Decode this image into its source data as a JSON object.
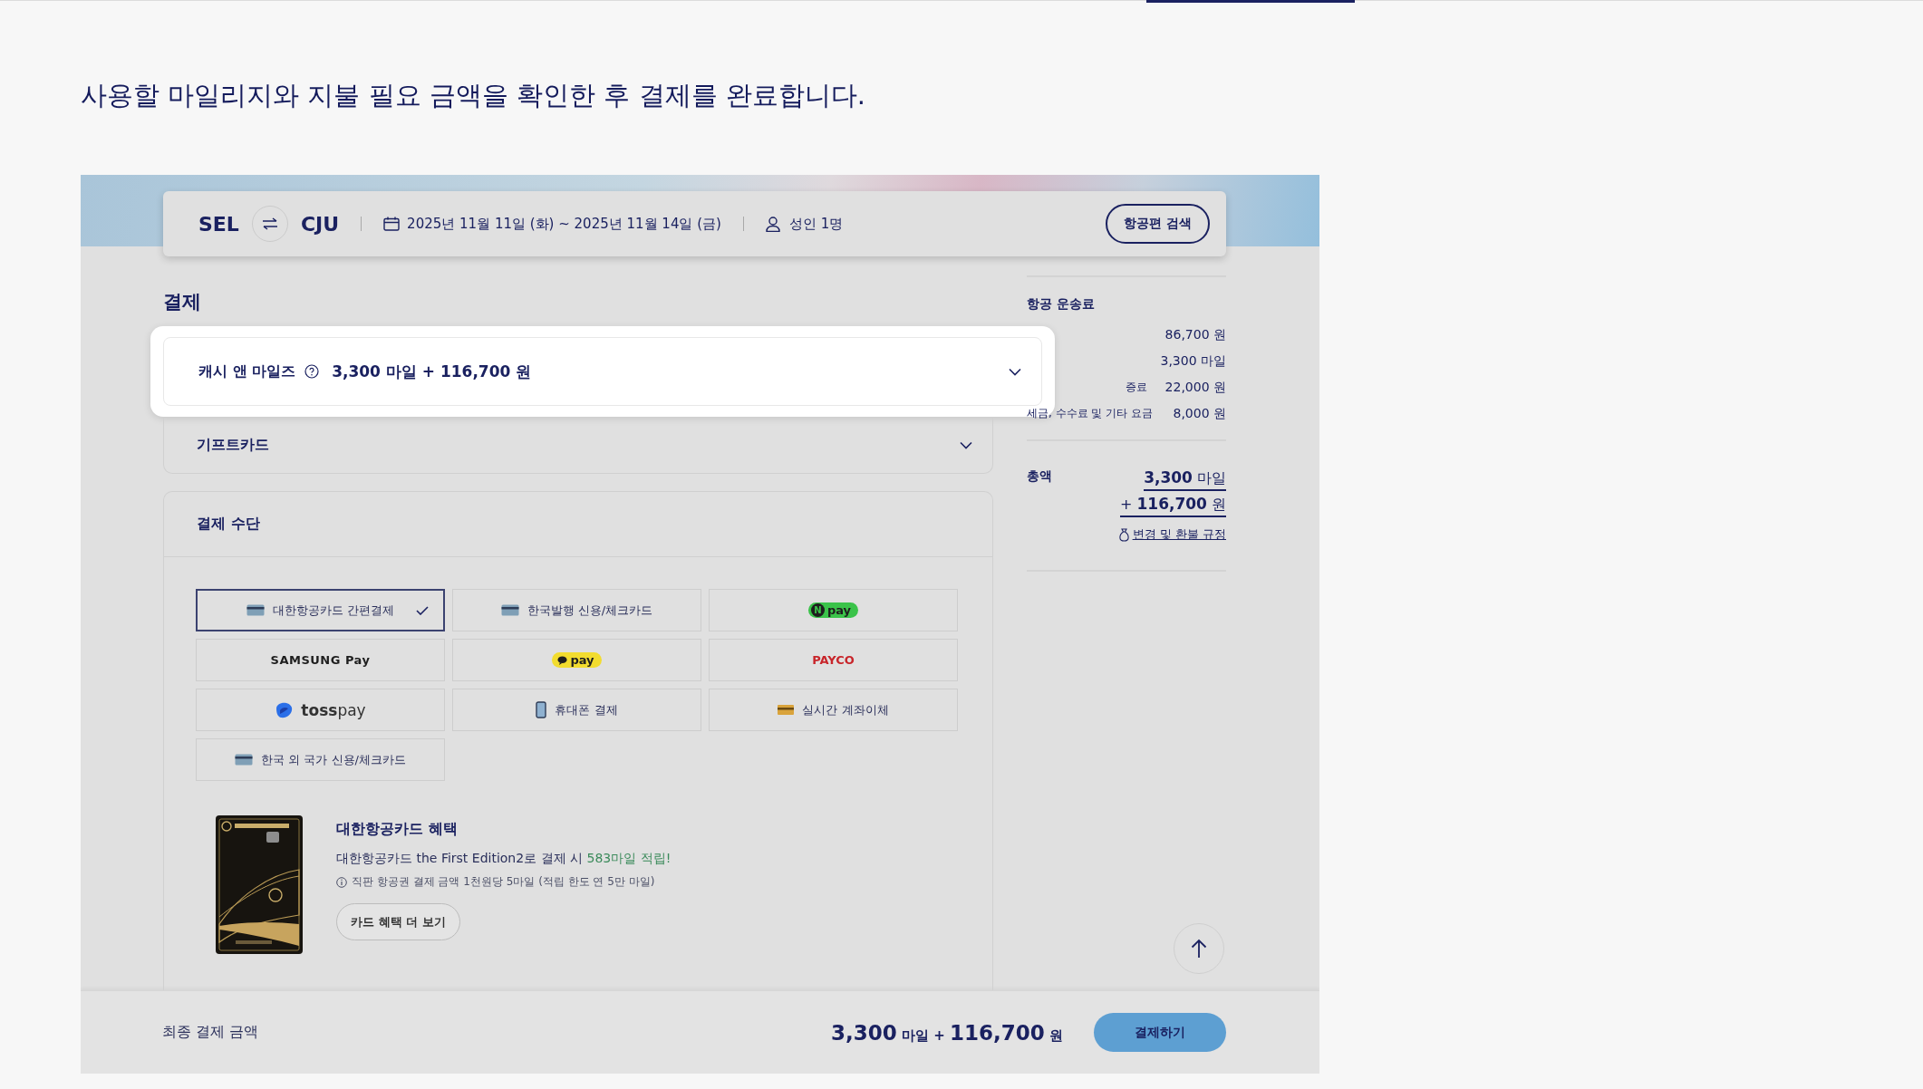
{
  "instruction": "사용할 마일리지와 지불 필요 금액을 확인한 후 결제를 완료합니다.",
  "search_bar": {
    "origin": "SEL",
    "destination": "CJU",
    "dates": "2025년 11월 11일 (화) ~ 2025년 11월 14일 (금)",
    "passengers": "성인 1명",
    "search_button": "항공편 검색"
  },
  "payment": {
    "title": "결제",
    "cash_and_miles": {
      "label": "캐시 앤 마일즈",
      "amount": "3,300 마일 + 116,700 원",
      "expanded": false,
      "highlighted": true
    },
    "gift_card": {
      "label": "기프트카드",
      "expanded": false
    },
    "methods_title": "결제 수단",
    "methods": [
      {
        "kind": "card",
        "label": "대한항공카드 간편결제",
        "selected": true
      },
      {
        "kind": "card",
        "label": "한국발행 신용/체크카드",
        "selected": false
      },
      {
        "kind": "npay",
        "badge": "N",
        "label": "pay",
        "selected": false
      },
      {
        "kind": "wordmark",
        "label": "SAMSUNG Pay",
        "selected": false
      },
      {
        "kind": "kakaopay",
        "label": "pay",
        "selected": false
      },
      {
        "kind": "payco",
        "label": "PAYCO",
        "selected": false
      },
      {
        "kind": "tosspay",
        "label": "**toss**pay",
        "selected": false
      },
      {
        "kind": "phone",
        "label": "휴대폰 결제",
        "selected": false
      },
      {
        "kind": "bank",
        "label": "실시간 계좌이체",
        "selected": false
      },
      {
        "kind": "card",
        "label": "한국 외 국가 신용/체크카드",
        "selected": false
      }
    ],
    "card_benefit": {
      "title": "대한항공카드 혜택",
      "text": "대한항공카드 the First Edition2로 결제 시 ",
      "highlight": "583마일 적립!",
      "note": "직판 항공권 결제 금액 1천원당 5마일 (적립 한도 연 5만 마일)",
      "button": "카드 혜택 더 보기"
    }
  },
  "fare_summary": {
    "title": "항공 운송료",
    "rows": [
      {
        "value": "86,700 원"
      },
      {
        "value": "3,300 마일"
      },
      {
        "label": "증료",
        "value": "22,000 원"
      },
      {
        "label": "세금, 수수료 및 기타 요금",
        "value": "8,000 원"
      }
    ],
    "total_label": "총액",
    "total_miles": "**3,300** 마일",
    "total_cash": "+ **116,700** 원",
    "refund_link": "변경 및 환불 규정"
  },
  "footer": {
    "label": "최종 결제 금액",
    "amount": "**3,300** 마일 + **116,700** 원",
    "pay_button": "결제하기"
  }
}
